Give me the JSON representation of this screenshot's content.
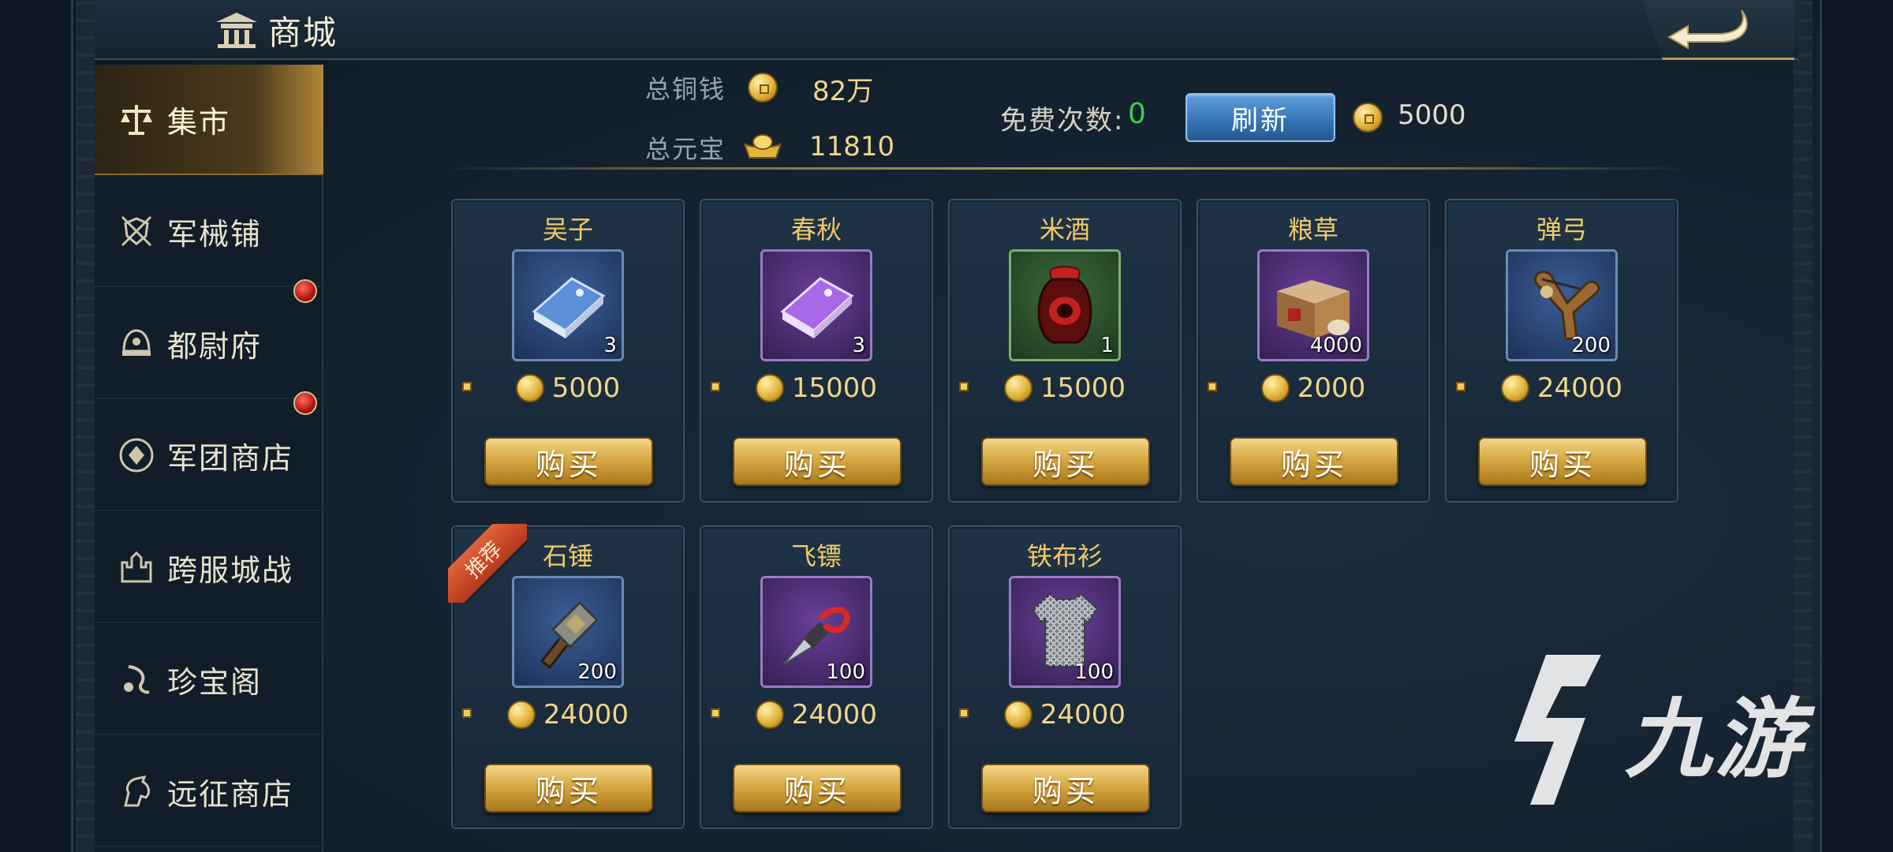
{
  "header": {
    "title": "商城",
    "back_icon": "back-arrow-icon"
  },
  "sidebar": {
    "items": [
      {
        "label": "集市",
        "icon": "scales-icon",
        "active": true,
        "badge": false
      },
      {
        "label": "军械铺",
        "icon": "shield-swords-icon",
        "active": false,
        "badge": false
      },
      {
        "label": "都尉府",
        "icon": "helmet-icon",
        "active": false,
        "badge": true
      },
      {
        "label": "军团商店",
        "icon": "emblem-icon",
        "active": false,
        "badge": true
      },
      {
        "label": "跨服城战",
        "icon": "castle-icon",
        "active": false,
        "badge": false
      },
      {
        "label": "珍宝阁",
        "icon": "treasure-icon",
        "active": false,
        "badge": false
      },
      {
        "label": "远征商店",
        "icon": "horse-icon",
        "active": false,
        "badge": false
      }
    ]
  },
  "currency": {
    "copper_label": "总铜钱",
    "copper_value": "82万",
    "yuanbao_label": "总元宝",
    "yuanbao_value": "11810",
    "free_label": "免费次数:",
    "free_value": "0",
    "refresh_label": "刷新",
    "refresh_cost": "5000"
  },
  "items": [
    {
      "name": "吴子",
      "qty": "3",
      "price": "5000",
      "icon": "blue-book-icon",
      "rarity": "blue",
      "recommended": false
    },
    {
      "name": "春秋",
      "qty": "3",
      "price": "15000",
      "icon": "purple-book-icon",
      "rarity": "purple",
      "recommended": false
    },
    {
      "name": "米酒",
      "qty": "1",
      "price": "15000",
      "icon": "wine-jar-icon",
      "rarity": "green",
      "recommended": false
    },
    {
      "name": "粮草",
      "qty": "4000",
      "price": "2000",
      "icon": "grain-crate-icon",
      "rarity": "purple",
      "recommended": false
    },
    {
      "name": "弹弓",
      "qty": "200",
      "price": "24000",
      "icon": "slingshot-icon",
      "rarity": "blue",
      "recommended": false
    },
    {
      "name": "石锤",
      "qty": "200",
      "price": "24000",
      "icon": "stone-hammer-icon",
      "rarity": "blue",
      "recommended": true
    },
    {
      "name": "飞镖",
      "qty": "100",
      "price": "24000",
      "icon": "dart-icon",
      "rarity": "purple",
      "recommended": false
    },
    {
      "name": "铁布衫",
      "qty": "100",
      "price": "24000",
      "icon": "chainmail-icon",
      "rarity": "purple",
      "recommended": false
    }
  ],
  "buy_label": "购买",
  "recommend_label": "推荐",
  "watermark": "九游"
}
